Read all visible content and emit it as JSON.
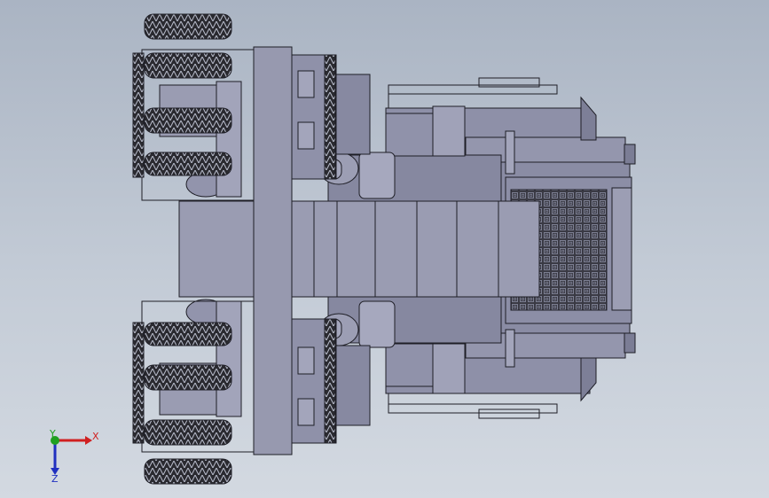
{
  "viewport": {
    "background_top": "#aab4c3",
    "background_bottom": "#d3d9e1"
  },
  "model": {
    "body_color": "#8e90a8",
    "body_light": "#a3a5bb",
    "body_dark": "#6f7189",
    "edge_color": "#1e1e26",
    "tire_color": "#2a2a30",
    "grille_color": "#3a3a44"
  },
  "triad": {
    "x_label": "X",
    "y_label": "Y",
    "z_label": "Z",
    "x_color": "#d02020",
    "y_color": "#20a020",
    "z_color": "#2030c0"
  }
}
